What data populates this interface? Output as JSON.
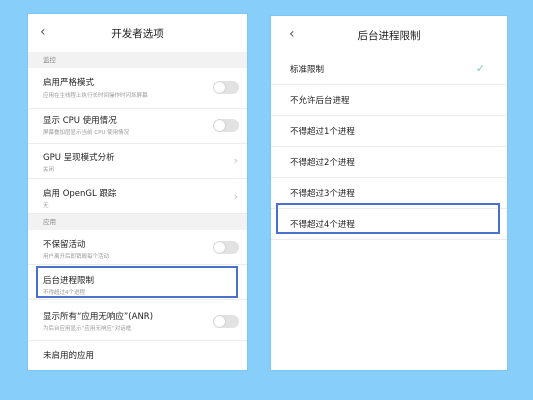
{
  "left": {
    "title": "开发者选项",
    "sections": [
      {
        "header": "监控",
        "rows": [
          {
            "label": "启用严格模式",
            "sub": "应用在主线程上执行长时间操作时闪烁屏幕",
            "control": "toggle",
            "on": false
          },
          {
            "label": "显示 CPU 使用情况",
            "sub": "屏幕叠加层显示当前 CPU 使用情况",
            "control": "toggle",
            "on": false
          },
          {
            "label": "GPU 呈现模式分析",
            "sub": "关闭",
            "control": "chevron"
          },
          {
            "label": "启用 OpenGL 跟踪",
            "sub": "无",
            "control": "chevron"
          }
        ]
      },
      {
        "header": "应用",
        "rows": [
          {
            "label": "不保留活动",
            "sub": "用户离开后即销毁每个活动",
            "control": "toggle",
            "on": false
          },
          {
            "label": "后台进程限制",
            "sub": "不得超过4个进程",
            "control": "none",
            "highlighted": true
          },
          {
            "label": "显示所有“应用无响应”(ANR)",
            "sub": "为后台应用显示“应用无响应”对话框",
            "control": "toggle",
            "on": false
          },
          {
            "label": "未启用的应用",
            "sub": "",
            "control": "none"
          }
        ]
      }
    ]
  },
  "right": {
    "title": "后台进程限制",
    "options": [
      {
        "label": "标准限制",
        "selected": true
      },
      {
        "label": "不允许后台进程",
        "selected": false
      },
      {
        "label": "不得超过1个进程",
        "selected": false
      },
      {
        "label": "不得超过2个进程",
        "selected": false
      },
      {
        "label": "不得超过3个进程",
        "selected": false
      },
      {
        "label": "不得超过4个进程",
        "selected": false,
        "highlighted": true
      }
    ]
  },
  "colors": {
    "background": "#87cefa",
    "highlight": "#4a72c8",
    "check": "#7dc9b0"
  },
  "icons": {
    "back": "chevron-left-icon",
    "forward": "chevron-right-icon",
    "selected": "checkmark-icon"
  }
}
